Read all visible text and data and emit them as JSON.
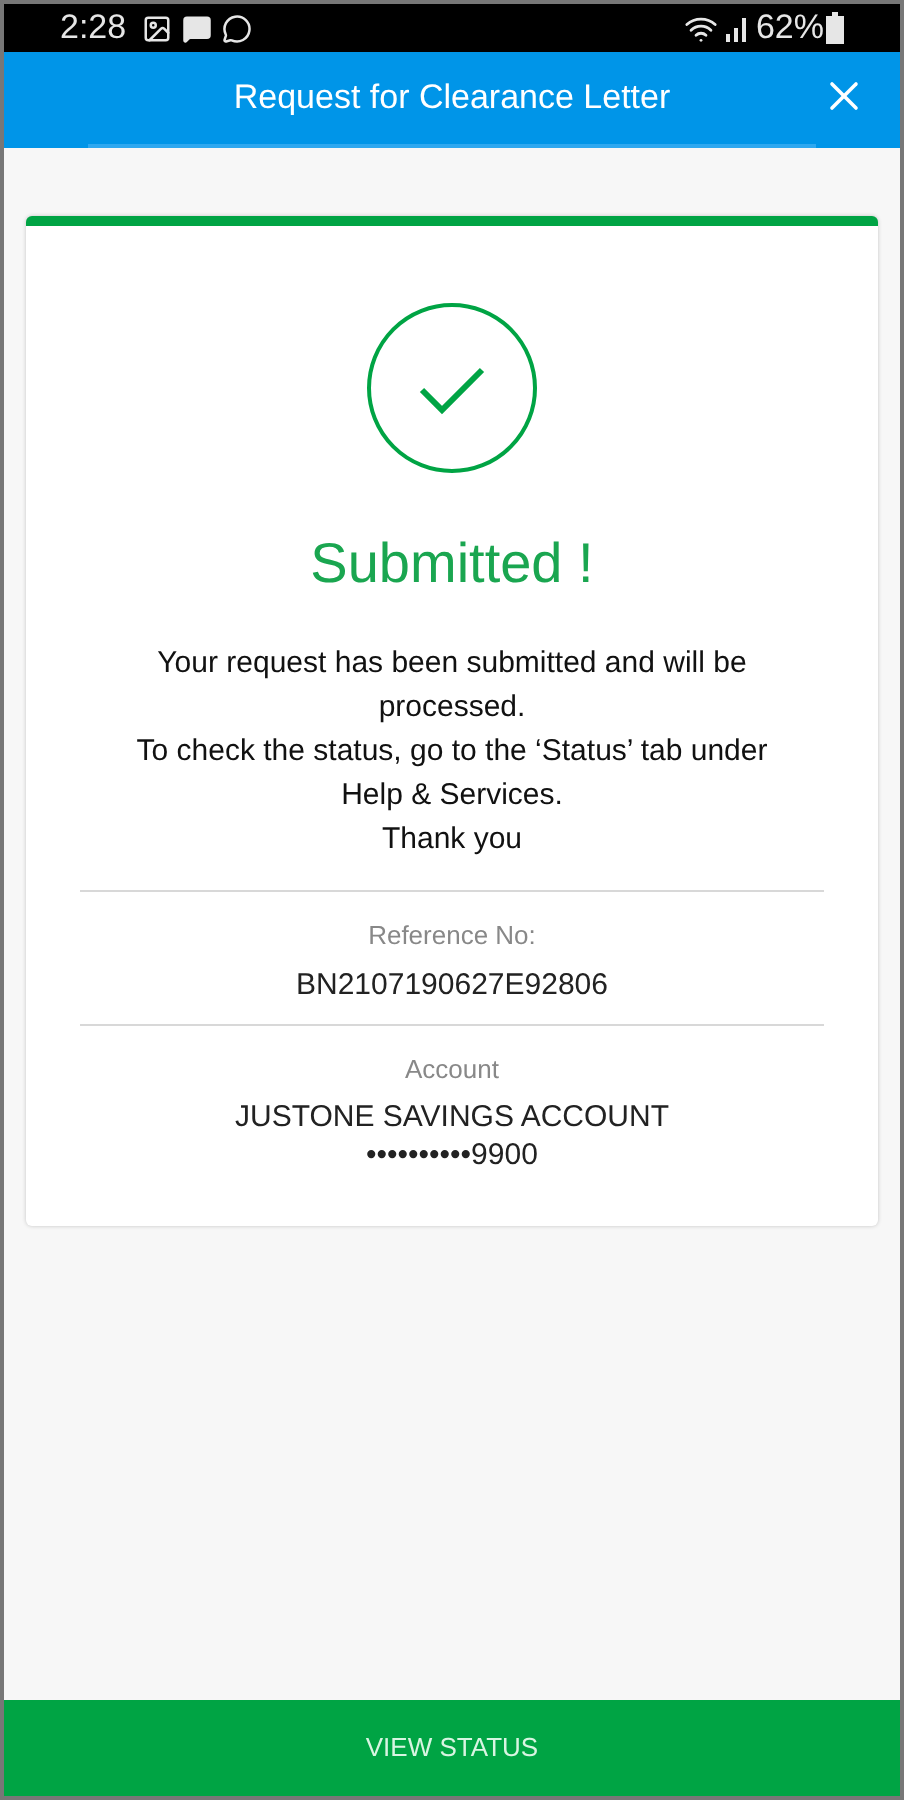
{
  "status_bar": {
    "time": "2:28",
    "battery": "62%"
  },
  "header": {
    "title": "Request for Clearance Letter"
  },
  "result": {
    "title": "Submitted !",
    "messages": [
      "Your request has been submitted and will be processed.",
      "To check the status, go to the ‘Status’ tab under Help & Services.",
      "Thank you"
    ]
  },
  "details": [
    {
      "label": "Reference No:",
      "values": [
        "BN2107190627E92806"
      ]
    },
    {
      "label": "Account",
      "values": [
        "JUSTONE SAVINGS ACCOUNT",
        "••••••••••9900"
      ]
    }
  ],
  "button": {
    "label": "VIEW STATUS"
  }
}
